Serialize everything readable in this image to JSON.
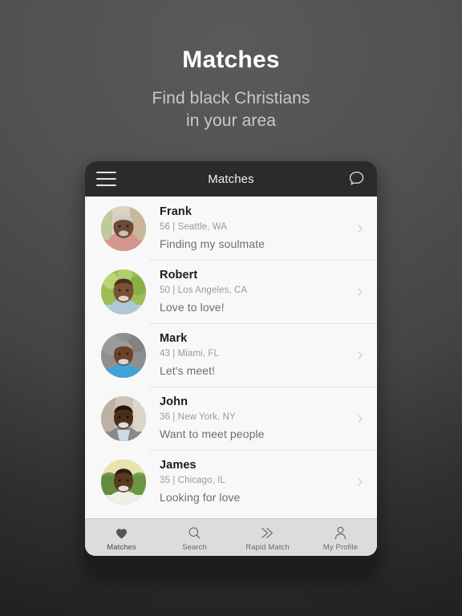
{
  "promo": {
    "title": "Matches",
    "subtitle_line1": "Find black Christians",
    "subtitle_line2": "in your area"
  },
  "app": {
    "navbar": {
      "menu_icon": "hamburger-menu-icon",
      "title": "Matches",
      "chat_icon": "chat-bubble-icon"
    },
    "matches": [
      {
        "name": "Frank",
        "meta": "56 | Seattle, WA",
        "tagline": "Finding my soulmate",
        "avatar": "photo-frank",
        "avatar_bg": "#d9cdbd",
        "skin": "#6d4a34",
        "shirt": "#d89a94",
        "hair": "#cfcfcf"
      },
      {
        "name": "Robert",
        "meta": "50 | Los Angeles, CA",
        "tagline": "Love to love!",
        "avatar": "photo-robert",
        "avatar_bg": "#96b84f",
        "skin": "#7a4f32",
        "shirt": "#b9cedd",
        "hair": "#4a3225"
      },
      {
        "name": "Mark",
        "meta": "43 | Miami, FL",
        "tagline": "Let's meet!",
        "avatar": "photo-mark",
        "avatar_bg": "#8c8c8c",
        "skin": "#6b4227",
        "shirt": "#3fa3d8",
        "hair": "#9c9c9c"
      },
      {
        "name": "John",
        "meta": "36 | New York, NY",
        "tagline": "Want to meet people",
        "avatar": "photo-john",
        "avatar_bg": "#c9bfb4",
        "skin": "#4a2d1c",
        "shirt": "#c6d4e0",
        "hair": "#241608"
      },
      {
        "name": "James",
        "meta": "35 | Chicago, IL",
        "tagline": "Looking for love",
        "avatar": "photo-james",
        "avatar_bg": "#6f9a46",
        "skin": "#5b3820",
        "shirt": "#eceae4",
        "hair": "#2a1d10"
      }
    ],
    "tabs": [
      {
        "label": "Matches",
        "icon": "heart-icon",
        "active": true
      },
      {
        "label": "Search",
        "icon": "search-icon",
        "active": false
      },
      {
        "label": "Rapid Match",
        "icon": "fast-forward-icon",
        "active": false
      },
      {
        "label": "My Profile",
        "icon": "person-icon",
        "active": false
      }
    ]
  },
  "colors": {
    "backdrop_top": "#5a5a5a",
    "backdrop_bottom": "#222222",
    "navbar_bg": "#2b2b2b",
    "list_bg": "#f8f8f8",
    "tabbar_bg": "#dcdcdc",
    "promo_title": "#ffffff",
    "promo_subtitle": "#c9c9c9",
    "name_text": "#1d1d1d",
    "meta_text": "#9a9a9a",
    "tagline_text": "#6e6e6e"
  }
}
